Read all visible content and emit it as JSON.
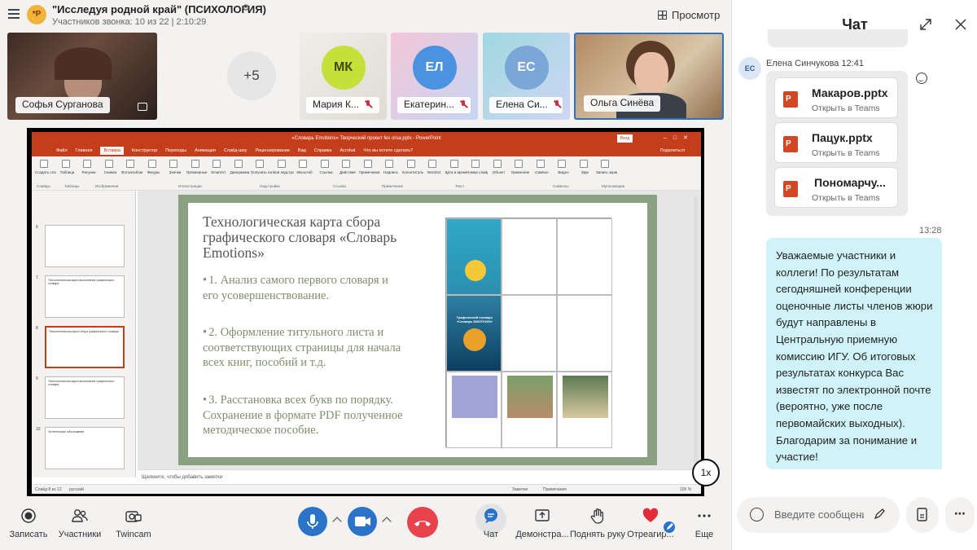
{
  "call": {
    "group_avatar": "*P",
    "title": "\"Исследуя родной край\" (ПСИХОЛОГИЯ)",
    "subtitle": "Участников звонка: 10 из 22 | 2:10:29",
    "preview_label": "Просмотр"
  },
  "participants": {
    "more_count": "+5",
    "tiles": [
      {
        "name": "Софья Сурганова",
        "video": true
      },
      {
        "initials": "МК",
        "name": "Мария К...",
        "muted": true,
        "color": "#c6e03a"
      },
      {
        "initials": "ЕЛ",
        "name": "Екатерин...",
        "muted": true,
        "color": "#4b92e0"
      },
      {
        "initials": "ЕС",
        "name": "Елена Си...",
        "muted": true,
        "color": "#7aa7d8"
      },
      {
        "name": "Ольга Синёва",
        "video": true,
        "active": true
      }
    ]
  },
  "presentation": {
    "window_title": "«Словарь Emotions» Творческий проект fes orsa.pptx - PowerPoint",
    "signin": "Вход",
    "tabs": [
      "Файл",
      "Главная",
      "Вставка",
      "Конструктор",
      "Переходы",
      "Анимация",
      "Слайд-шоу",
      "Рецензирование",
      "Вид",
      "Справка",
      "Acrobat",
      "Что вы хотите сделать?"
    ],
    "share_label": "Поделиться",
    "ribbon_groups": [
      "Слайды",
      "Таблицы",
      "Изображения",
      "Иллюстрации",
      "Надстройки",
      "Ссылки",
      "Примечания",
      "Текст",
      "Символы",
      "Мультимедиа"
    ],
    "ribbon_items": [
      "Создать слайд",
      "Таблица",
      "Рисунки",
      "Снимок",
      "Фотоальбом",
      "Фигуры",
      "Значки",
      "Трехмерные модели",
      "SmartArt",
      "Диаграмма",
      "Получить надстройки",
      "Мои надстройки",
      "Масштаб",
      "Ссылка",
      "Действие",
      "Примечание",
      "Надпись",
      "Колонтитулы",
      "WordArt",
      "Дата и время",
      "Номер слайда",
      "Объект",
      "Уравнение",
      "Символ",
      "Видео",
      "Звук",
      "Запись экрана"
    ],
    "thumbnails": [
      {
        "num": "6",
        "text": ""
      },
      {
        "num": "7",
        "text": "Технологическая карта выполнения графического словаря"
      },
      {
        "num": "8",
        "text": "Технологическая карта сбора графического словаря",
        "selected": true
      },
      {
        "num": "9",
        "text": "Технологическая карта выполнения графического словаря"
      },
      {
        "num": "10",
        "text": "Эстетическое обоснование"
      }
    ],
    "slide": {
      "heading": "Технологическая карта сбора графического словаря «Словарь Emotions»",
      "bullets": [
        "1. Анализ самого первого словаря и его усовершенствование.",
        "2. Оформление титульного листа и соответствующих страницы для начала всех книг, пособий и т.д.",
        "3. Расстановка всех букв по порядку. Сохранение в формате PDF полученное методическое пособие."
      ],
      "grid_caption": "Графический словарь «Словарь EMOTIONS»"
    },
    "notes_placeholder": "Щелкните, чтобы добавить заметки",
    "status_left": "Слайд 8 из 12",
    "status_lang": "русский",
    "status_notes": "Заметки",
    "status_comments": "Примечания",
    "zoom": "100 %",
    "playback_speed": "1x"
  },
  "toolbar": {
    "record": "Записать",
    "participants": "Участники",
    "twincam": "Twincam",
    "chat": "Чат",
    "demo": "Демонстра...",
    "raise_hand": "Поднять руку",
    "react": "Отреагир...",
    "more": "Еще"
  },
  "chat": {
    "title": "Чат",
    "sender_initials": "ЕС",
    "sender_line": "Елена Синчукова 12:41",
    "open_label": "Открыть в Teams",
    "files": [
      "Макаров.pptx",
      "Пацук.pptx",
      "Пономарчу..."
    ],
    "time2": "13:28",
    "message": "Уважаемые участники и коллеги! По результатам сегодняшней конференции оценочные листы членов жюри будут направлены в Центральную приемную комиссию ИГУ. Об итоговых результатах конкурса Вас известят по электронной почте (вероятно, уже после первомайских выходных). Благодарим за понимание и участие!",
    "input_placeholder": "Введите сообщение"
  },
  "colors": {
    "accent": "#2a73c9",
    "hangup": "#e8434c",
    "ppt_red": "#c43e1c",
    "msg_bubble": "#cff3f8",
    "slide_frame": "#8b9f81"
  }
}
